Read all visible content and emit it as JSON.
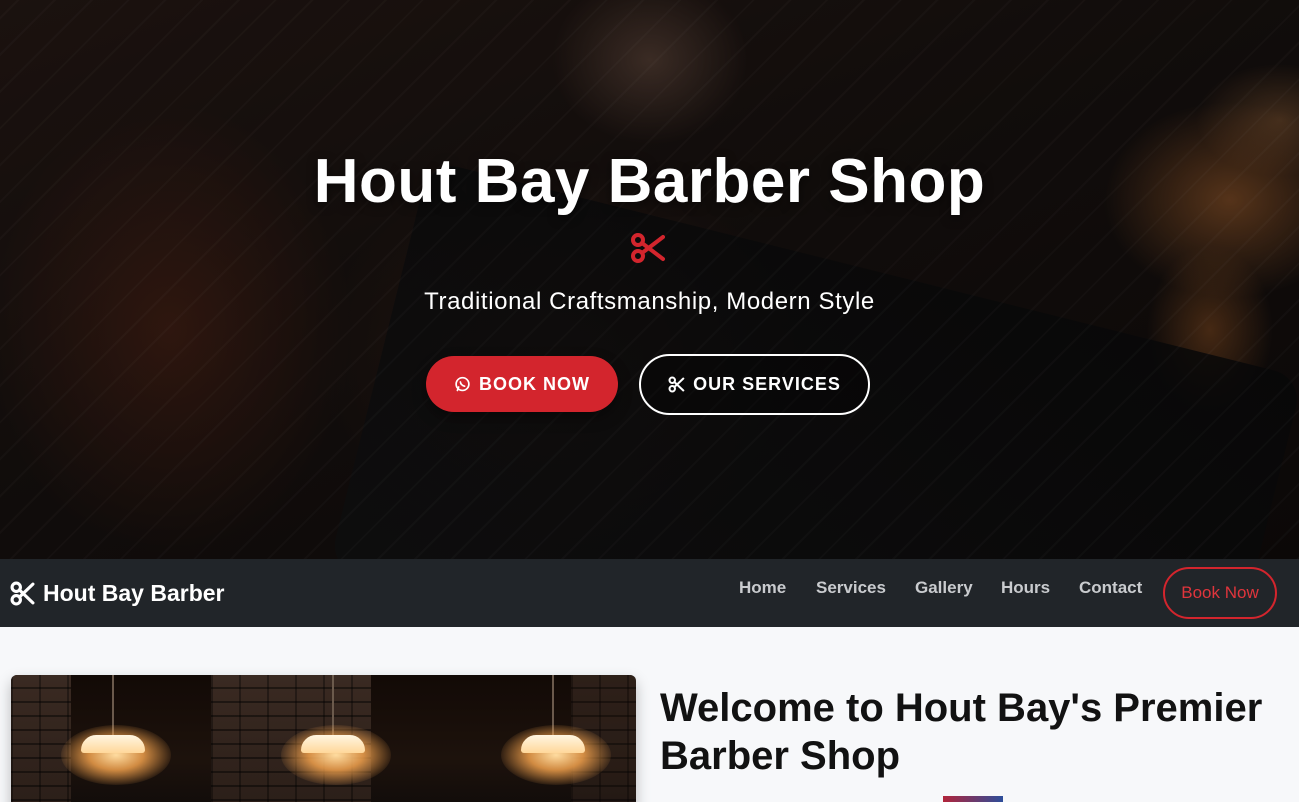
{
  "hero": {
    "title": "Hout Bay Barber Shop",
    "divider_icon": "scissors-icon",
    "subtitle": "Traditional Craftsmanship, Modern Style",
    "buttons": [
      {
        "label": "BOOK NOW",
        "icon": "whatsapp-icon",
        "color": "#d3252d"
      },
      {
        "label": "OUR SERVICES",
        "icon": "scissors-icon"
      }
    ]
  },
  "navbar": {
    "brand": "Hout Bay Barber",
    "brand_icon": "scissors-icon",
    "links": [
      "Home",
      "Services",
      "Gallery",
      "Hours",
      "Contact"
    ],
    "cta": "Book Now"
  },
  "about": {
    "title": "Welcome to Hout Bay's Premier Barber Shop"
  },
  "colors": {
    "accent": "#d3252d",
    "navbar_bg": "#212529",
    "page_bg": "#f7f8fa"
  }
}
